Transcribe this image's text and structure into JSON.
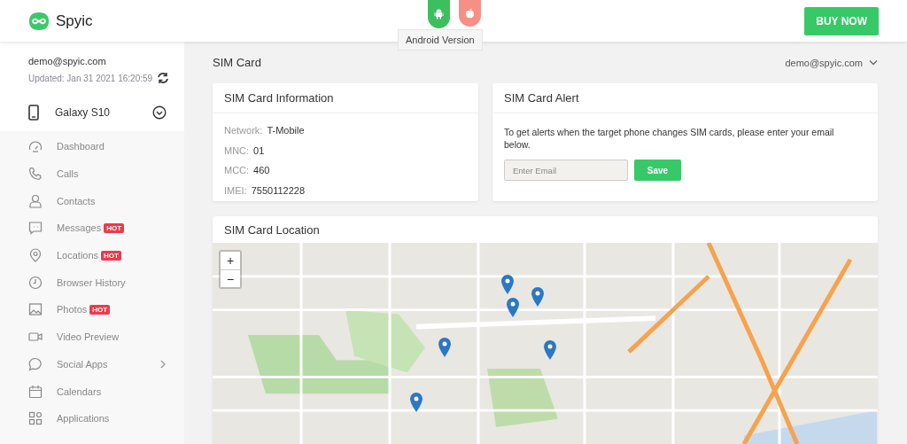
{
  "header": {
    "brand": "Spyic",
    "platform_tabs": [
      {
        "kind": "android",
        "selected": true
      },
      {
        "kind": "ios",
        "selected": false
      }
    ],
    "tooltip": "Android Version",
    "buy_button": "BUY NOW"
  },
  "account": {
    "email": "demo@spyic.com",
    "updated": "Updated: Jan 31 2021 16:20:59",
    "device": "Galaxy S10"
  },
  "sidebar": {
    "items": [
      {
        "label": "Dashboard"
      },
      {
        "label": "Calls"
      },
      {
        "label": "Contacts"
      },
      {
        "label": "Messages",
        "badge": "HOT"
      },
      {
        "label": "Locations",
        "badge": "HOT"
      },
      {
        "label": "Browser History"
      },
      {
        "label": "Photos",
        "badge": "HOT"
      },
      {
        "label": "Video Preview"
      },
      {
        "label": "Social Apps",
        "has_submenu": true
      },
      {
        "label": "Calendars"
      },
      {
        "label": "Applications"
      }
    ]
  },
  "page": {
    "title": "SIM Card",
    "user_menu": "demo@spyic.com"
  },
  "info_card": {
    "title": "SIM Card Information",
    "fields": [
      {
        "label": "Network:",
        "value": "T-Mobile"
      },
      {
        "label": "MNC:",
        "value": "01"
      },
      {
        "label": "MCC:",
        "value": "460"
      },
      {
        "label": "IMEI:",
        "value": "7550112228"
      }
    ]
  },
  "alert_card": {
    "title": "SIM Card Alert",
    "text": "To get alerts when the target phone changes SIM cards, please enter your email below.",
    "email_placeholder": "Enter Email",
    "save_button": "Save"
  },
  "location_card": {
    "title": "SIM Card Location",
    "zoom_in": "+",
    "zoom_out": "−"
  }
}
